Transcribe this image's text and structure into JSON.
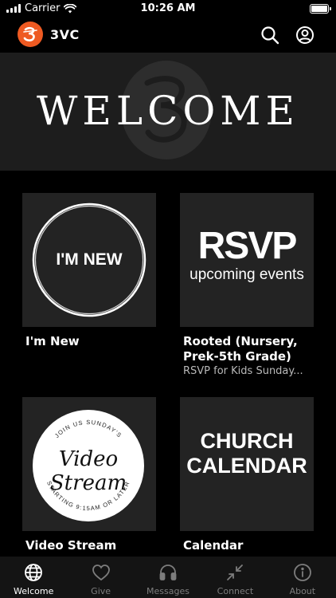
{
  "status_bar": {
    "carrier": "Carrier",
    "time": "10:26 AM"
  },
  "header": {
    "title": "3VC",
    "logo_color": "#ee5a22"
  },
  "banner": {
    "title": "WELCOME"
  },
  "cards": [
    {
      "tile_text": "I'M NEW",
      "title": "I'm New",
      "subtitle": ""
    },
    {
      "tile_big": "RSVP",
      "tile_small": "upcoming events",
      "title": "Rooted (Nursery, Prek-5th Grade)",
      "subtitle": "RSVP for Kids Sunday..."
    },
    {
      "tile_top_arc": "JOIN US SUNDAY'S",
      "tile_line1": "Video",
      "tile_line2": "Stream",
      "tile_bottom_arc": "STARTING 9:15AM OR LATER",
      "title": "Video Stream",
      "subtitle": ""
    },
    {
      "tile_line1": "CHURCH",
      "tile_line2": "CALENDAR",
      "title": "Calendar",
      "subtitle": ""
    }
  ],
  "tabs": [
    {
      "label": "Welcome",
      "icon": "globe-icon",
      "active": true
    },
    {
      "label": "Give",
      "icon": "heart-icon",
      "active": false
    },
    {
      "label": "Messages",
      "icon": "headphones-icon",
      "active": false
    },
    {
      "label": "Connect",
      "icon": "arrows-icon",
      "active": false
    },
    {
      "label": "About",
      "icon": "info-icon",
      "active": false
    }
  ],
  "colors": {
    "background": "#000000",
    "tile": "#232323",
    "accent": "#ee5a22",
    "tab_active": "#ffffff",
    "tab_inactive": "#7d7d7d"
  }
}
